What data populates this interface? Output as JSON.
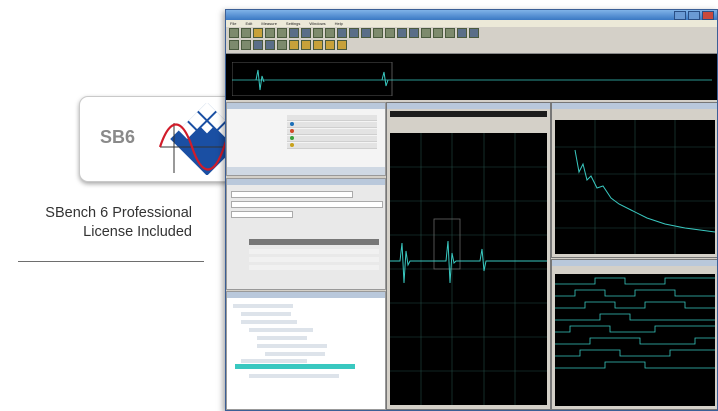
{
  "badge": {
    "label": "SB6"
  },
  "promo": {
    "line1": "SBench 6 Professional",
    "line2": "License Included"
  },
  "app": {
    "menu": [
      "File",
      "Edit",
      "Measure",
      "Settings",
      "Windows",
      "Help"
    ],
    "colors": {
      "accent": "#3a78c3",
      "trace": "#39c8c0",
      "logo_blue": "#1a4fa3",
      "logo_red": "#d11c2a"
    }
  },
  "icons": {
    "logo": "sbench-logo-icon",
    "close": "close-icon",
    "minimize": "minimize-icon",
    "maximize": "maximize-icon"
  }
}
